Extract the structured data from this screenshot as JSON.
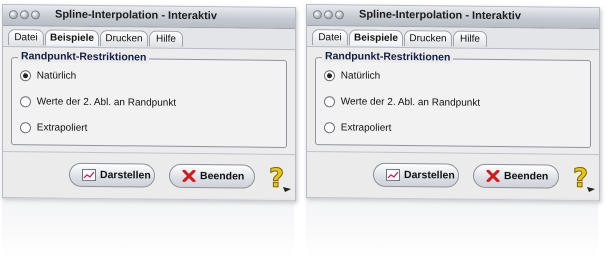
{
  "windows": [
    {
      "title": "Spline-Interpolation - Interaktiv",
      "menu": [
        "Datei",
        "Beispiele",
        "Drucken",
        "Hilfe"
      ],
      "group_title": "Randpunkt-Restriktionen",
      "options": [
        "Natürlich",
        "Werte der 2. Abl. an Randpunkt",
        "Extrapoliert"
      ],
      "selected_index": 0,
      "buttons": {
        "show": "Darstellen",
        "quit": "Beenden"
      }
    },
    {
      "title": "Spline-Interpolation - Interaktiv",
      "menu": [
        "Datei",
        "Beispiele",
        "Drucken",
        "Hilfe"
      ],
      "group_title": "Randpunkt-Restriktionen",
      "options": [
        "Natürlich",
        "Werte der 2. Abl. an Randpunkt",
        "Extrapoliert"
      ],
      "selected_index": 0,
      "buttons": {
        "show": "Darstellen",
        "quit": "Beenden"
      }
    }
  ],
  "icons": {
    "window_controls": "window-control-icons",
    "show_button": "chart-icon",
    "quit_button": "close-x-icon",
    "help": "help-question-icon"
  },
  "colors": {
    "quit_x": "#d21a1a",
    "help_icon": "#f2c600",
    "group_title": "#121c46"
  }
}
